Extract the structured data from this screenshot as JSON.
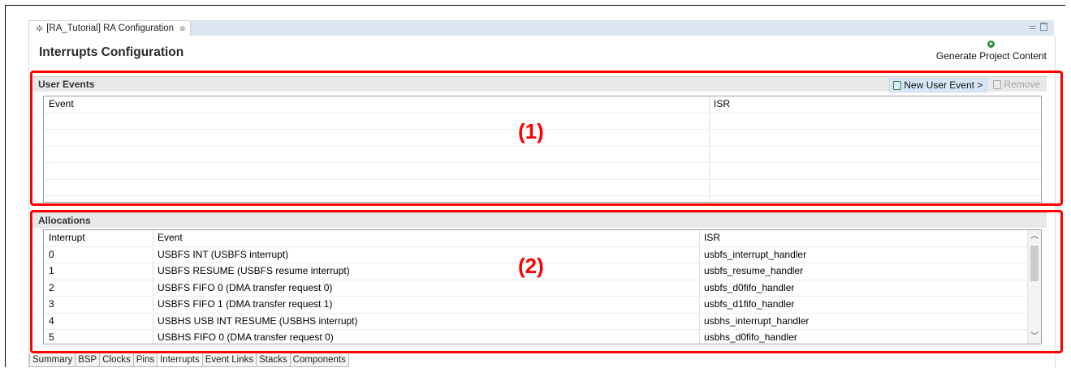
{
  "window": {
    "tab_title": "[RA_Tutorial] RA Configuration",
    "tab_close_glyph": "⊗"
  },
  "page": {
    "title": "Interrupts Configuration",
    "generate_label": "Generate Project Content"
  },
  "user_events": {
    "title": "User Events",
    "new_button": "New User Event >",
    "remove_button": "Remove",
    "columns": [
      "Event",
      "ISR"
    ],
    "rows": []
  },
  "allocations": {
    "title": "Allocations",
    "columns": [
      "Interrupt",
      "Event",
      "ISR"
    ],
    "rows": [
      {
        "interrupt": "0",
        "event": "USBFS INT (USBFS interrupt)",
        "isr": "usbfs_interrupt_handler"
      },
      {
        "interrupt": "1",
        "event": "USBFS RESUME (USBFS resume interrupt)",
        "isr": "usbfs_resume_handler"
      },
      {
        "interrupt": "2",
        "event": "USBFS FIFO 0 (DMA transfer request 0)",
        "isr": "usbfs_d0fifo_handler"
      },
      {
        "interrupt": "3",
        "event": "USBFS FIFO 1 (DMA transfer request 1)",
        "isr": "usbfs_d1fifo_handler"
      },
      {
        "interrupt": "4",
        "event": "USBHS USB INT RESUME (USBHS interrupt)",
        "isr": "usbhs_interrupt_handler"
      },
      {
        "interrupt": "5",
        "event": "USBHS FIFO 0 (DMA transfer request 0)",
        "isr": "usbhs_d0fifo_handler"
      }
    ]
  },
  "bottom_tabs": [
    "Summary",
    "BSP",
    "Clocks",
    "Pins",
    "Interrupts",
    "Event Links",
    "Stacks",
    "Components"
  ],
  "active_bottom_tab": "Interrupts",
  "annotations": {
    "box1": "(1)",
    "box2": "(2)"
  },
  "colors": {
    "highlight": "#ff0000",
    "tab_strip": "#dce6f2",
    "generate_icon": "#2d8f3f"
  },
  "icons": {
    "tab": "gear-icon",
    "generate": "play-icon",
    "new": "add-icon",
    "remove": "remove-icon"
  }
}
